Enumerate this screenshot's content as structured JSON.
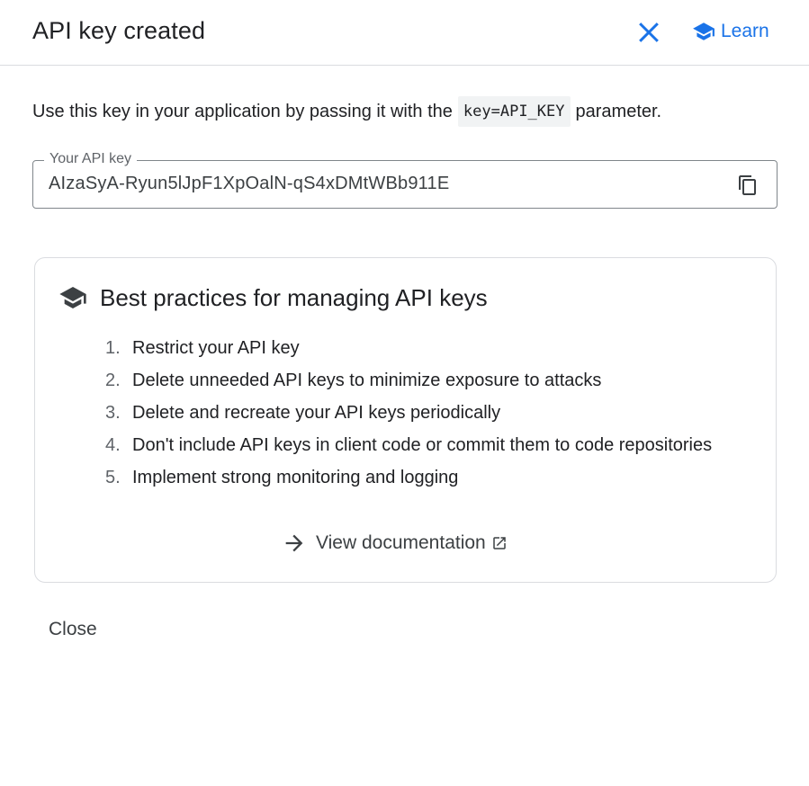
{
  "dialog": {
    "title": "API key created",
    "learn_label": "Learn"
  },
  "description": {
    "before": "Use this key in your application by passing it with the",
    "code": "key=API_KEY",
    "after": "parameter."
  },
  "api_key_field": {
    "label": "Your API key",
    "value": "AIzaSyA-Ryun5lJpF1XpOalN-qS4xDMtWBb911E"
  },
  "best_practices": {
    "title": "Best practices for managing API keys",
    "items": [
      {
        "num": "1.",
        "text": "Restrict your API key"
      },
      {
        "num": "2.",
        "text": "Delete unneeded API keys to minimize exposure to attacks"
      },
      {
        "num": "3.",
        "text": "Delete and recreate your API keys periodically"
      },
      {
        "num": "4.",
        "text": "Don't include API keys in client code or commit them to code repositories"
      },
      {
        "num": "5.",
        "text": "Implement strong monitoring and logging"
      }
    ],
    "doc_link_label": "View documentation"
  },
  "footer": {
    "close_label": "Close"
  },
  "colors": {
    "accent": "#1a73e8",
    "text": "#202124",
    "divider": "#dadce0"
  },
  "icons": [
    "close-icon",
    "school-icon",
    "copy-icon",
    "arrow-right-icon",
    "open-in-new-icon"
  ]
}
